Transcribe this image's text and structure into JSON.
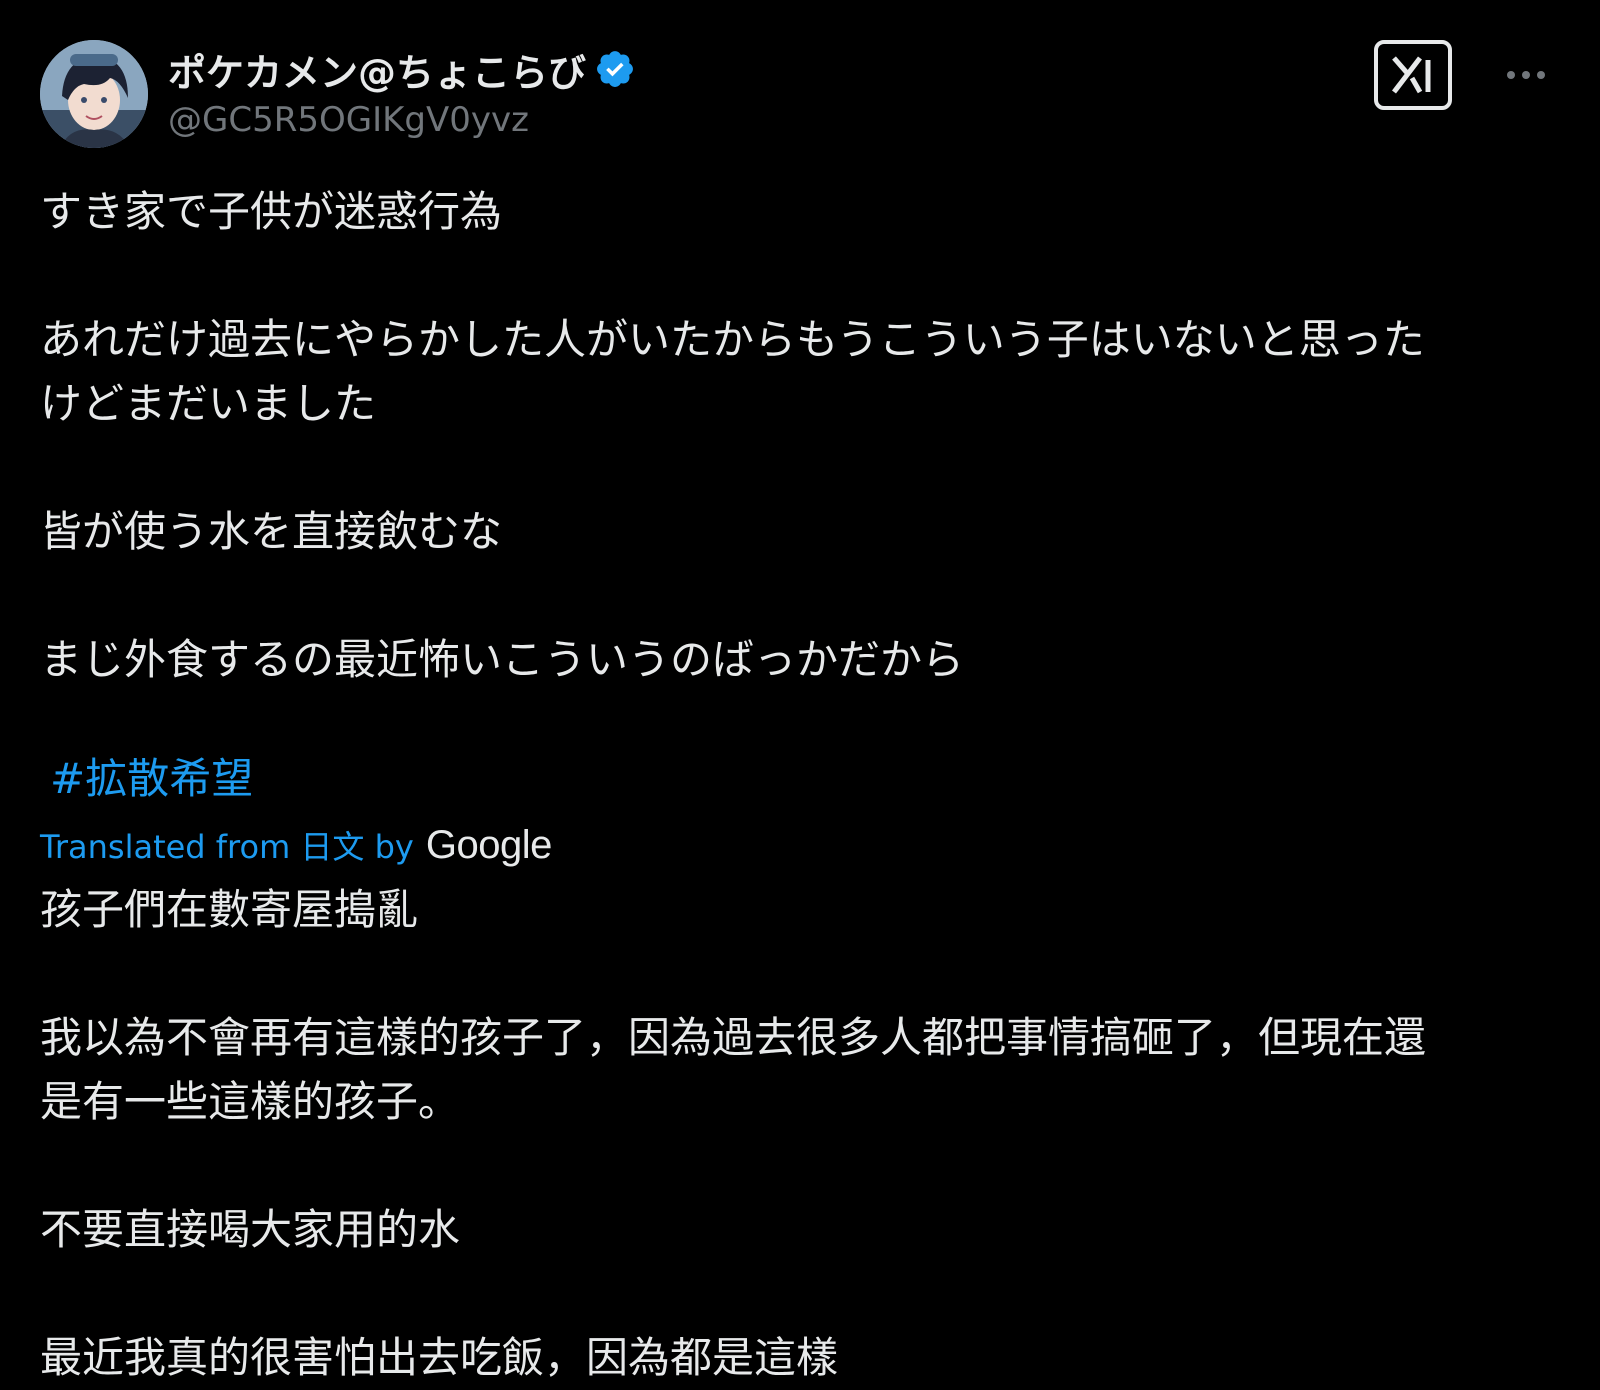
{
  "author": {
    "display_name": "ポケカメン@ちょこらび",
    "handle": "@GC5R5OGIKgV0yvz",
    "verified": true,
    "verified_color": "#1d9bf0"
  },
  "actions": {
    "grok_icon": "grok-icon",
    "more_icon": "more-horizontal-icon"
  },
  "post": {
    "original_text": "すき家で子供が迷惑行為\n\nあれだけ過去にやらかした人がいたからもうこういう子はいないと思った\nけどまだいました\n\n皆が使う水を直接飲むな\n\nまじ外食するの最近怖いこういうのばっかだから",
    "hashtag": "#拡散希望",
    "translation_label": "Translated from 日文 by",
    "translation_provider": "Google",
    "translated_text": "孩子們在數寄屋搗亂\n\n我以為不會再有這樣的孩子了，因為過去很多人都把事情搞砸了，但現在還\n是有一些這樣的孩子。\n\n不要直接喝大家用的水\n\n最近我真的很害怕出去吃飯，因為都是這樣"
  },
  "colors": {
    "background": "#000000",
    "text": "#e7e9ea",
    "secondary_text": "#71767b",
    "link": "#1d9bf0"
  }
}
